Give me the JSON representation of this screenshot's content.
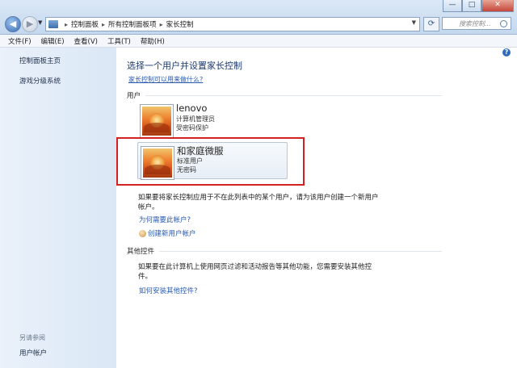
{
  "window": {
    "breadcrumb": [
      "控制面板",
      "所有控制面板项",
      "家长控制"
    ],
    "search_placeholder": "搜索控制...",
    "controls": {
      "minimize": "—",
      "maximize": "□",
      "close": "✕"
    }
  },
  "menu": [
    "文件(F)",
    "编辑(E)",
    "查看(V)",
    "工具(T)",
    "帮助(H)"
  ],
  "sidebar": {
    "items": [
      "控制面板主页",
      "游戏分级系统"
    ],
    "see_also_label": "另请参阅",
    "see_also_items": [
      "用户帐户"
    ]
  },
  "main": {
    "heading": "选择一个用户并设置家长控制",
    "info_link": "家长控制可以用来做什么?",
    "users_section": "用户",
    "users": [
      {
        "name": "lenovo",
        "type": "计算机管理员",
        "password": "受密码保护"
      },
      {
        "name": "和家庭微服",
        "type": "标准用户",
        "password": "无密码"
      }
    ],
    "add_user_text": "如果要将家长控制应用于不在此列表中的某个用户，请为该用户创建一个新用户帐户。",
    "why_account_link": "为何需要此帐户?",
    "create_account_link": "创建新用户帐户",
    "other_section": "其他控件",
    "other_text": "如果要在此计算机上使用网页过滤和活动报告等其他功能，您需要安装其他控件。",
    "install_link": "如何安装其他控件?"
  },
  "colors": {
    "highlight": "#d32121",
    "link": "#2a59b0",
    "heading": "#1e3a6e"
  },
  "icons": [
    "back-icon",
    "forward-icon",
    "control-panel-icon",
    "refresh-icon",
    "search-icon",
    "help-icon",
    "user-avatar-icon",
    "create-user-icon"
  ]
}
